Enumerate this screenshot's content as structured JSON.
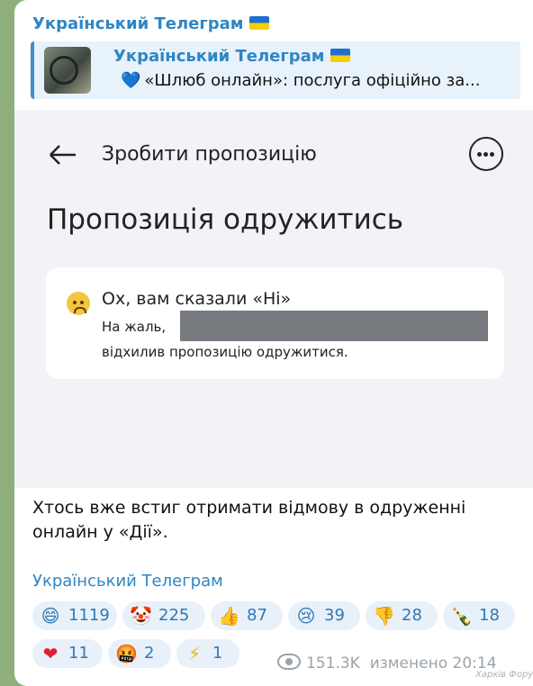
{
  "message": {
    "channel_name": "Український Телеграм",
    "reply": {
      "title": "Український Телеграм",
      "text": "«Шлюб онлайн»: послуга офіційно за..."
    },
    "screenshot": {
      "header_title": "Зробити пропозицію",
      "heading": "Пропозиція одружитись",
      "card_title": "Ох, вам сказали «Ні»",
      "card_line1": "На жаль,",
      "card_line2": "відхилив пропозицію одружитися."
    },
    "body_text": "Хтось вже встиг отримати відмову в одруженні онлайн у «Дії».",
    "signature": "Український Телеграм",
    "reactions": [
      {
        "icon": "grinning-face",
        "glyph": "😄",
        "count": "1119"
      },
      {
        "icon": "clown-face",
        "glyph": "🤡",
        "count": "225"
      },
      {
        "icon": "thumbs-up",
        "glyph": "👍",
        "count": "87"
      },
      {
        "icon": "crying-face",
        "glyph": "😢",
        "count": "39"
      },
      {
        "icon": "thumbs-down",
        "glyph": "👎",
        "count": "28"
      },
      {
        "icon": "champagne",
        "glyph": "🍾",
        "count": "18"
      },
      {
        "icon": "red-heart",
        "glyph": "❤",
        "count": "11"
      },
      {
        "icon": "cursing-face",
        "glyph": "🤬",
        "count": "2"
      },
      {
        "icon": "lightning",
        "glyph": "⚡",
        "count": "1"
      }
    ],
    "views": "151.3K",
    "edited_label": "изменено",
    "time": "20:14"
  },
  "watermark": "Харків Форум",
  "colors": {
    "accent": "#2f86c4",
    "reaction_bg": "#e8f1fa",
    "chat_bg": "#8fae7c"
  }
}
